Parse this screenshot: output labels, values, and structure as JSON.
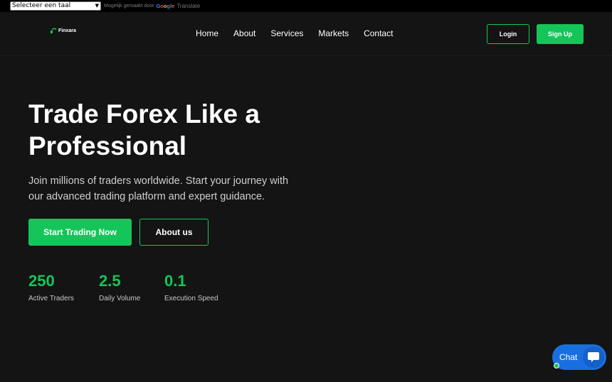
{
  "translate": {
    "select_value": "Selecteer een taal",
    "powered_by": "Mogelijk gemaakt door",
    "google": [
      "G",
      "o",
      "o",
      "g",
      "l",
      "e"
    ],
    "translate_word": "Translate"
  },
  "header": {
    "logo_text": "Finxara",
    "nav": [
      "Home",
      "About",
      "Services",
      "Markets",
      "Contact"
    ],
    "login_label": "Login",
    "signup_label": "Sign Up"
  },
  "hero": {
    "title_line1": "Trade Forex Like a",
    "title_line2": "Professional",
    "subtitle": "Join millions of traders worldwide. Start your journey with our advanced trading platform and expert guidance.",
    "start_label": "Start Trading Now",
    "about_label": "About us"
  },
  "stats": [
    {
      "value": "250",
      "label": "Active Traders"
    },
    {
      "value": "2.5",
      "label": "Daily Volume"
    },
    {
      "value": "0.1",
      "label": "Execution Speed"
    }
  ],
  "chat": {
    "label": "Chat",
    "icon": "chat-bubble-icon"
  },
  "colors": {
    "accent": "#16c55a",
    "background": "#141414",
    "chat": "#1a6fe0"
  }
}
